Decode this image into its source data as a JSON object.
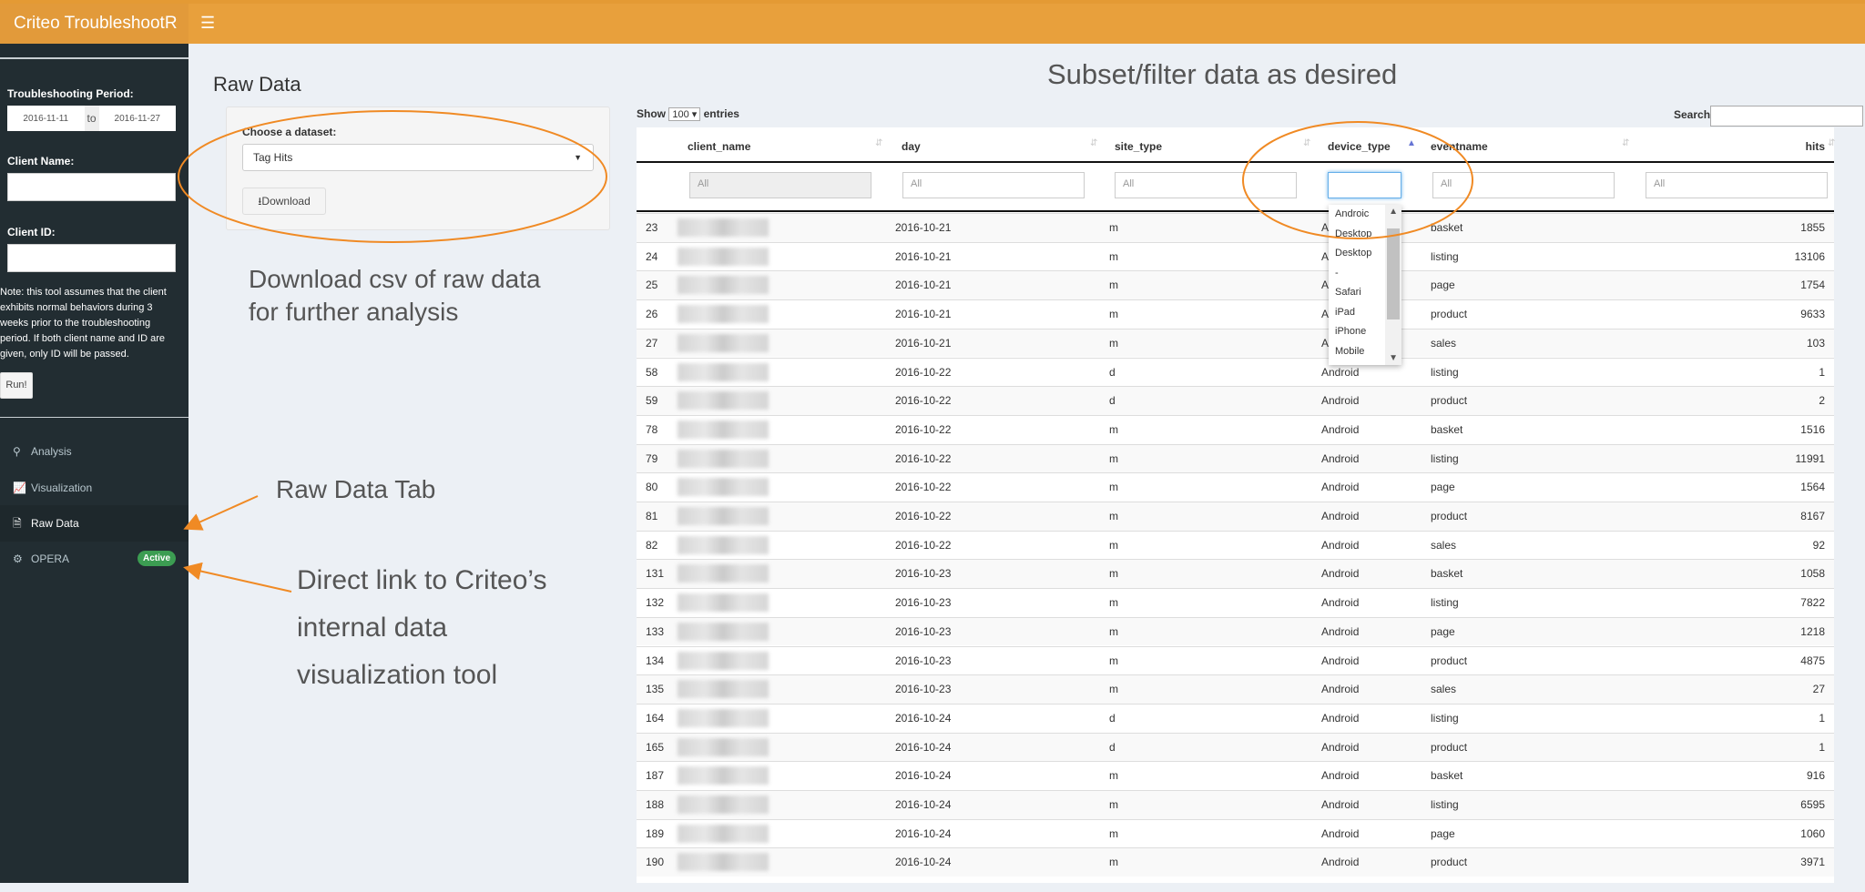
{
  "app": {
    "title": "Criteo TroubleshootR",
    "menu_icon": "hamburger-icon",
    "accent": "#e8a03c"
  },
  "sidebar": {
    "period_label": "Troubleshooting Period:",
    "start_date": "2016-11-11",
    "to": "to",
    "end_date": "2016-11-27",
    "client_name_label": "Client Name:",
    "client_name_value": "",
    "client_id_label": "Client ID:",
    "client_id_value": "",
    "note": "Note: this tool assumes that the client exhibits normal behaviors during 3 weeks prior to the troubleshooting period. If both client name and ID are given, only ID will be passed.",
    "run_label": "Run!",
    "items": [
      {
        "label": "Analysis",
        "icon": "lightbulb-icon"
      },
      {
        "label": "Visualization",
        "icon": "line-chart-icon"
      },
      {
        "label": "Raw Data",
        "icon": "file-excel-icon",
        "active": true
      },
      {
        "label": "OPERA",
        "icon": "dashboard-icon",
        "badge": "Active",
        "badge_color": "#3c9d52"
      }
    ]
  },
  "main": {
    "title": "Raw Data",
    "dataset_label": "Choose a dataset:",
    "dataset_value": "Tag Hits",
    "download_label": "Download"
  },
  "annotations": {
    "download": [
      "Download csv of raw data",
      "for further analysis"
    ],
    "raw_tab": "Raw Data Tab",
    "opera": [
      "Direct link to Criteo’s",
      "internal data",
      "visualization tool"
    ],
    "filter": "Subset/filter data as desired",
    "color": "#f08a24"
  },
  "table": {
    "show_label": "Show",
    "length": "100",
    "entries_label": "entries",
    "search_label": "Search:",
    "search_value": "",
    "columns": [
      "client_name",
      "day",
      "site_type",
      "device_type",
      "eventname",
      "hits"
    ],
    "sorted_column": "device_type",
    "filters": [
      "All",
      "All",
      "All",
      "",
      "All",
      "All"
    ],
    "device_options": [
      "Androic",
      "Desktop",
      "Desktop",
      "-",
      "Safari",
      "iPad",
      "iPhone",
      "Mobile"
    ],
    "rows": [
      [
        "23",
        "2016-10-21",
        "m",
        "Android",
        "basket",
        "1855"
      ],
      [
        "24",
        "2016-10-21",
        "m",
        "Android",
        "listing",
        "13106"
      ],
      [
        "25",
        "2016-10-21",
        "m",
        "Android",
        "page",
        "1754"
      ],
      [
        "26",
        "2016-10-21",
        "m",
        "Android",
        "product",
        "9633"
      ],
      [
        "27",
        "2016-10-21",
        "m",
        "Android",
        "sales",
        "103"
      ],
      [
        "58",
        "2016-10-22",
        "d",
        "Android",
        "listing",
        "1"
      ],
      [
        "59",
        "2016-10-22",
        "d",
        "Android",
        "product",
        "2"
      ],
      [
        "78",
        "2016-10-22",
        "m",
        "Android",
        "basket",
        "1516"
      ],
      [
        "79",
        "2016-10-22",
        "m",
        "Android",
        "listing",
        "11991"
      ],
      [
        "80",
        "2016-10-22",
        "m",
        "Android",
        "page",
        "1564"
      ],
      [
        "81",
        "2016-10-22",
        "m",
        "Android",
        "product",
        "8167"
      ],
      [
        "82",
        "2016-10-22",
        "m",
        "Android",
        "sales",
        "92"
      ],
      [
        "131",
        "2016-10-23",
        "m",
        "Android",
        "basket",
        "1058"
      ],
      [
        "132",
        "2016-10-23",
        "m",
        "Android",
        "listing",
        "7822"
      ],
      [
        "133",
        "2016-10-23",
        "m",
        "Android",
        "page",
        "1218"
      ],
      [
        "134",
        "2016-10-23",
        "m",
        "Android",
        "product",
        "4875"
      ],
      [
        "135",
        "2016-10-23",
        "m",
        "Android",
        "sales",
        "27"
      ],
      [
        "164",
        "2016-10-24",
        "d",
        "Android",
        "listing",
        "1"
      ],
      [
        "165",
        "2016-10-24",
        "d",
        "Android",
        "product",
        "1"
      ],
      [
        "187",
        "2016-10-24",
        "m",
        "Android",
        "basket",
        "916"
      ],
      [
        "188",
        "2016-10-24",
        "m",
        "Android",
        "listing",
        "6595"
      ],
      [
        "189",
        "2016-10-24",
        "m",
        "Android",
        "page",
        "1060"
      ],
      [
        "190",
        "2016-10-24",
        "m",
        "Android",
        "product",
        "3971"
      ]
    ]
  }
}
